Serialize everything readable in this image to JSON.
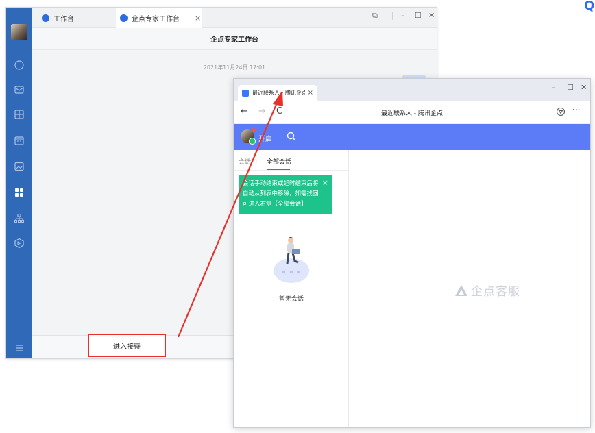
{
  "back_window": {
    "tabs": [
      {
        "label": "工作台",
        "icon": "grid-circle-icon",
        "icon_color": "#2d6cdf"
      },
      {
        "label": "企点专家工作台",
        "icon": "info-circle-icon",
        "icon_color": "#2d6cdf",
        "close": "×"
      }
    ],
    "window_controls": {
      "pin": "⧉",
      "min": "–",
      "max": "☐",
      "close": "✕"
    },
    "title": "企点专家工作台",
    "date": "2021年11月24日 17:01",
    "enter_button": "进入接待",
    "sidebar_icons": [
      "chat-bubble-icon",
      "mail-icon",
      "box-icon",
      "calendar-icon",
      "image-icon",
      "apps-grid-icon",
      "org-chart-icon",
      "cube-icon",
      "menu-icon"
    ],
    "sidebar_color": "#2f69b8"
  },
  "browser_window": {
    "tab_title": "最近联系人 - 腾讯企点",
    "tab_close": "×",
    "window_controls": {
      "min": "–",
      "max": "☐",
      "close": "✕"
    },
    "nav": {
      "back": "←",
      "forward": "→",
      "reload": "C"
    },
    "page_title": "最近联系人 - 腾讯企点",
    "more": "···",
    "status": "开启",
    "tabs": [
      "会话中",
      "全部会话"
    ],
    "tip": "会话手动结束或超时结束后将自动从列表中移除，如需找回可进入右侧【全部会话】",
    "tip_close": "×",
    "empty_text": "暂无会话",
    "watermark": "企点客服",
    "accent_color": "#5b7cf6",
    "tip_color": "#1ec28b"
  },
  "annotation_color": "#e8312a"
}
